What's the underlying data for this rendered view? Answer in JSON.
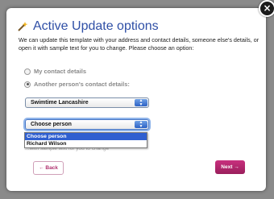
{
  "dialog": {
    "title": "Active Update options",
    "intro": "We can update this template with your address and contact details, someone else's details, or open it with sample text for you to change. Please choose an option:",
    "close_glyph": "×"
  },
  "options": {
    "my_contact": {
      "label": "My contact details",
      "checked": false
    },
    "other_person": {
      "label": "Another person's contact details:",
      "checked": true
    }
  },
  "organisation_select": {
    "value": "Swimtime Lancashire"
  },
  "person_select": {
    "value": "Choose person",
    "options": [
      "Choose person",
      "Richard Wilson"
    ],
    "selected_index": 0
  },
  "obscured_text": "…with sample text for you to change",
  "buttons": {
    "back": "← Back",
    "next": "Next →"
  },
  "colors": {
    "title": "#2f4fa6",
    "accent": "#b0306e",
    "selection": "#2f5fd0"
  }
}
